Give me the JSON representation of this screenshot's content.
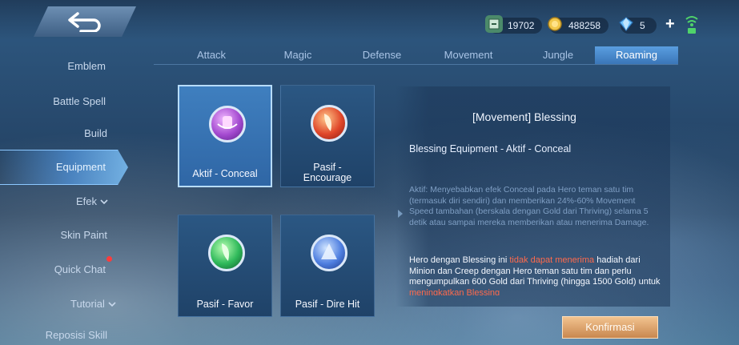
{
  "currencies": [
    {
      "icon": "ticket-icon",
      "value": "19702"
    },
    {
      "icon": "gold-coin-icon",
      "value": "488258"
    },
    {
      "icon": "diamond-icon",
      "value": "5"
    }
  ],
  "add_label": "+",
  "menu": [
    {
      "label": "Emblem"
    },
    {
      "label": "Battle Spell"
    },
    {
      "label": "Build"
    },
    {
      "label": "Equipment"
    },
    {
      "label": "Efek"
    },
    {
      "label": "Skin Paint"
    },
    {
      "label": "Quick Chat"
    },
    {
      "label": "Tutorial"
    },
    {
      "label": "Reposisi Skill"
    }
  ],
  "tabs": [
    "Attack",
    "Magic",
    "Defense",
    "Movement",
    "Jungle",
    "Roaming"
  ],
  "active_tab": "Roaming",
  "cards": [
    {
      "label": "Aktif - Conceal",
      "icon": "conceal-icon",
      "selected": true
    },
    {
      "label": "Pasif -\nEncourage",
      "icon": "encourage-icon",
      "selected": false
    },
    {
      "label": "Pasif - Favor",
      "icon": "favor-icon",
      "selected": false
    },
    {
      "label": "Pasif - Dire Hit",
      "icon": "dire-hit-icon",
      "selected": false
    }
  ],
  "detail": {
    "title": "[Movement] Blessing",
    "subtitle": "Blessing Equipment - Aktif - Conceal",
    "description": "Aktif: Menyebabkan efek Conceal pada Hero teman satu tim (termasuk diri sendiri) dan memberikan 24%-60% Movement Speed tambahan (berskala dengan Gold dari Thriving) selama 5 detik atau sampai mereka memberikan atau menerima Damage.",
    "passive_prefix": "Hero dengan Blessing ini",
    "passive_highlight_1": "tidak dapat menerima",
    "passive_mid": "hadiah dari Minion dan Creep dengan Hero teman satu tim dan perlu mengumpulkan 600 Gold dari Thriving (hingga 1500 Gold) untuk",
    "passive_highlight_2": "meningkatkan Blessing"
  },
  "confirm_label": "Konfirmasi",
  "colors": {
    "accent": "#5a9ee0",
    "highlight": "#ff6a4c",
    "confirm": "#d99a5f"
  }
}
